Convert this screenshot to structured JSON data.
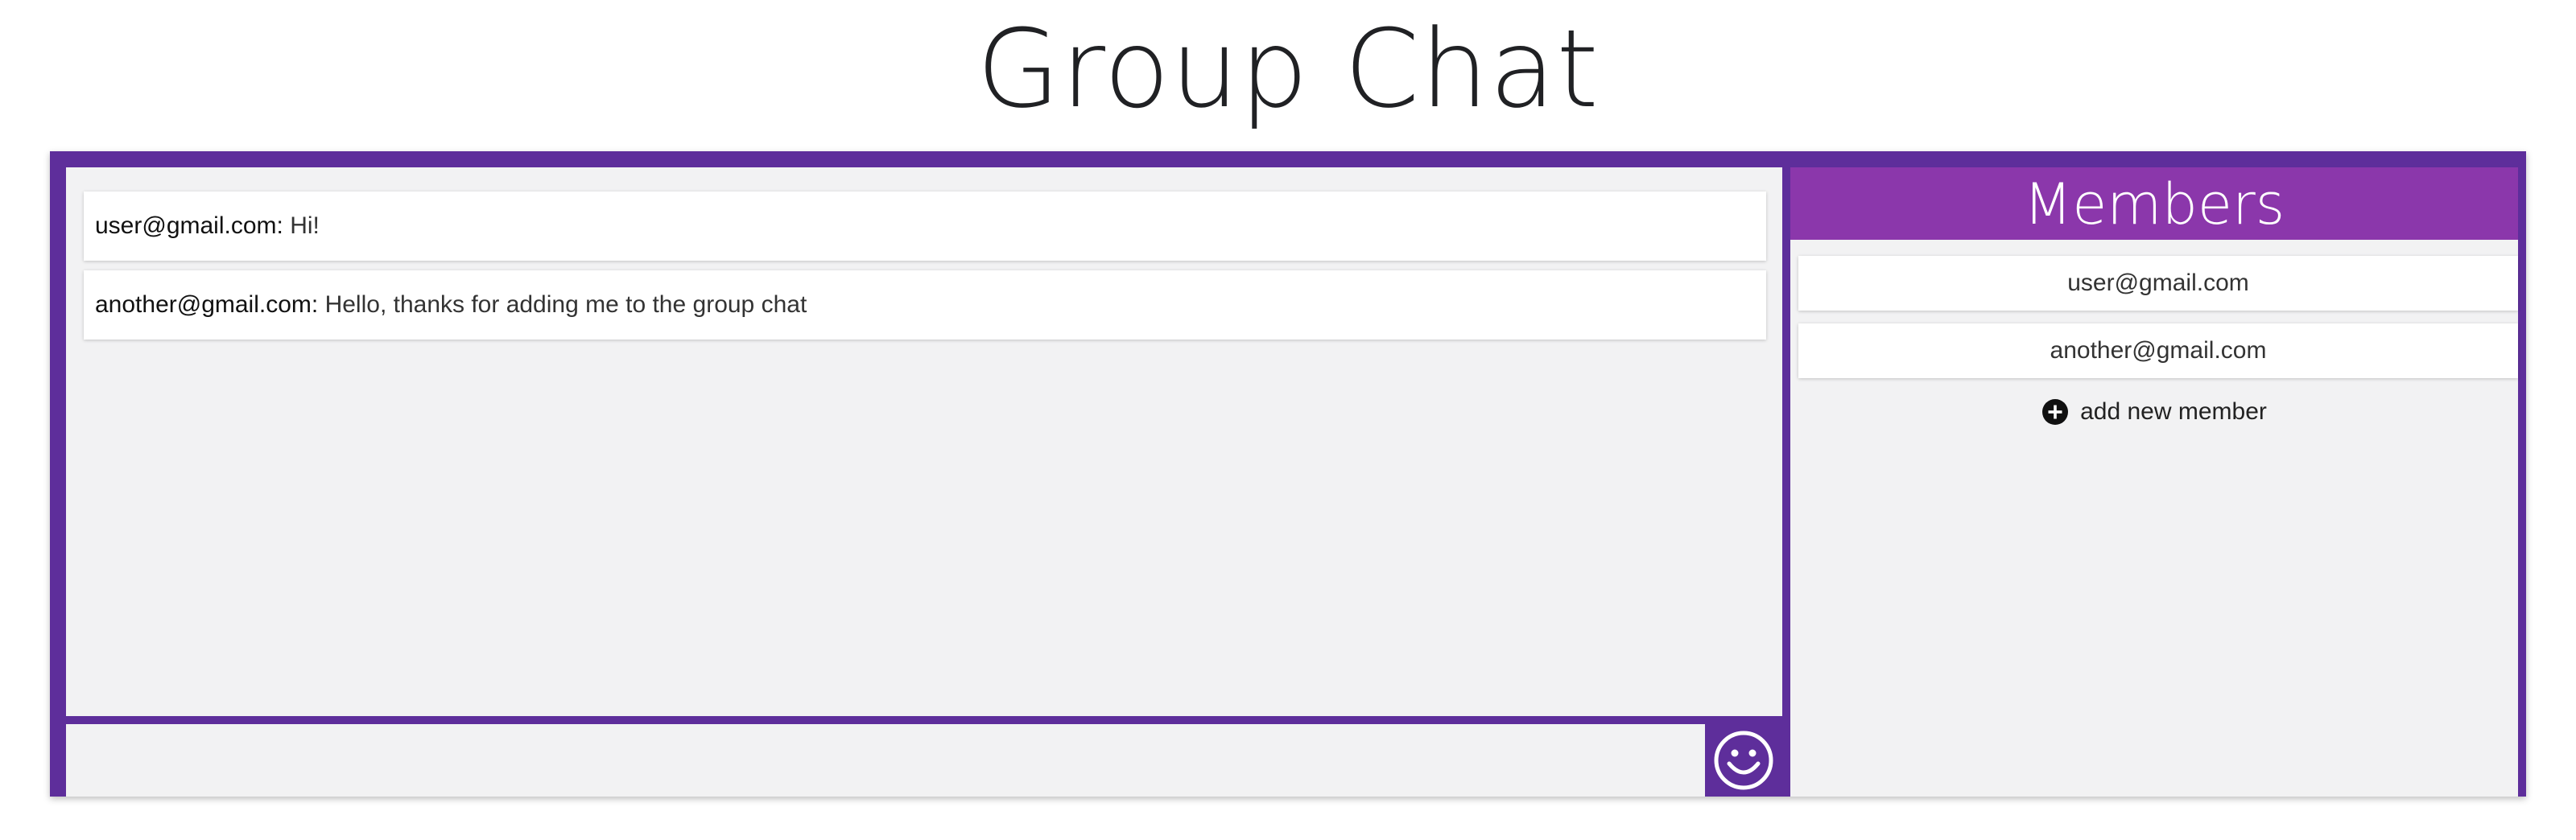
{
  "page": {
    "title": "Group Chat"
  },
  "chat": {
    "messages": [
      {
        "sender": "user@gmail.com:",
        "text": " Hi!"
      },
      {
        "sender": "another@gmail.com:",
        "text": " Hello, thanks for adding me to the group chat"
      }
    ],
    "input": {
      "value": "",
      "placeholder": ""
    },
    "emoji_icon": "smiley-face-icon"
  },
  "members": {
    "header": "Members",
    "items": [
      "user@gmail.com",
      "another@gmail.com"
    ],
    "add_label": "add new member",
    "add_icon": "plus-circle-icon"
  },
  "colors": {
    "frame": "#5e2e9b",
    "header": "#8b37ab",
    "pane_background": "#f2f2f3"
  }
}
